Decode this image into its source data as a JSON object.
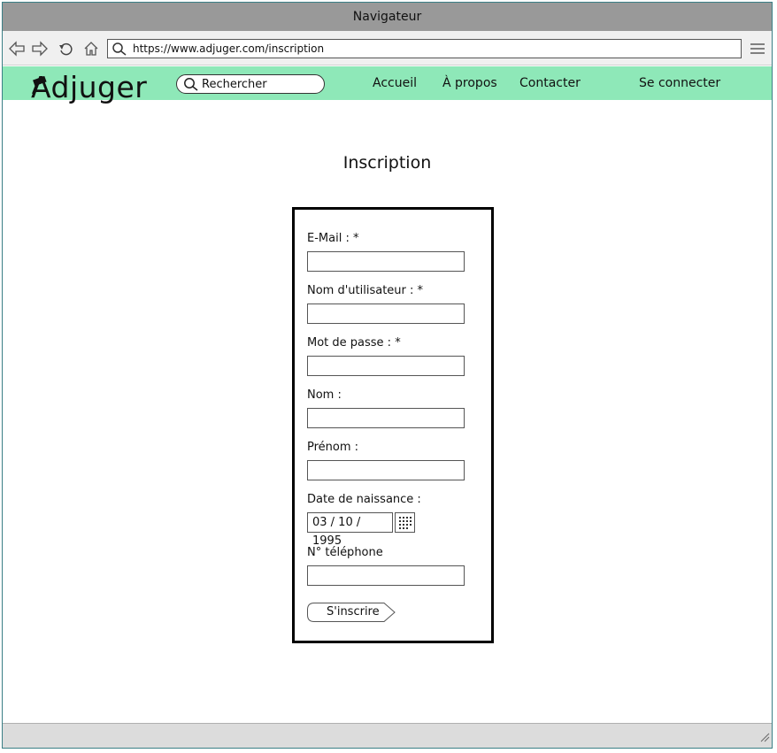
{
  "window": {
    "title": "Navigateur"
  },
  "browser": {
    "url": "https://www.adjuger.com/inscription",
    "icons": [
      "back-icon",
      "forward-icon",
      "reload-icon",
      "home-icon",
      "search-icon",
      "menu-icon"
    ]
  },
  "site": {
    "logo": "Adjuger",
    "search_label": "Rechercher",
    "nav": {
      "accueil": "Accueil",
      "apropos": "À propos",
      "contacter": "Contacter",
      "login": "Se connecter"
    },
    "accent_color": "#8ee8b8"
  },
  "page": {
    "title": "Inscription"
  },
  "form": {
    "email_label": "E-Mail : *",
    "username_label": "Nom d'utilisateur : *",
    "password_label": "Mot de passe : *",
    "lastname_label": "Nom :",
    "firstname_label": "Prénom :",
    "birthdate_label": "Date de naissance :",
    "birthdate_value": "03 / 10 / 1995",
    "phone_label": "N° téléphone",
    "submit_label": "S'inscrire"
  }
}
